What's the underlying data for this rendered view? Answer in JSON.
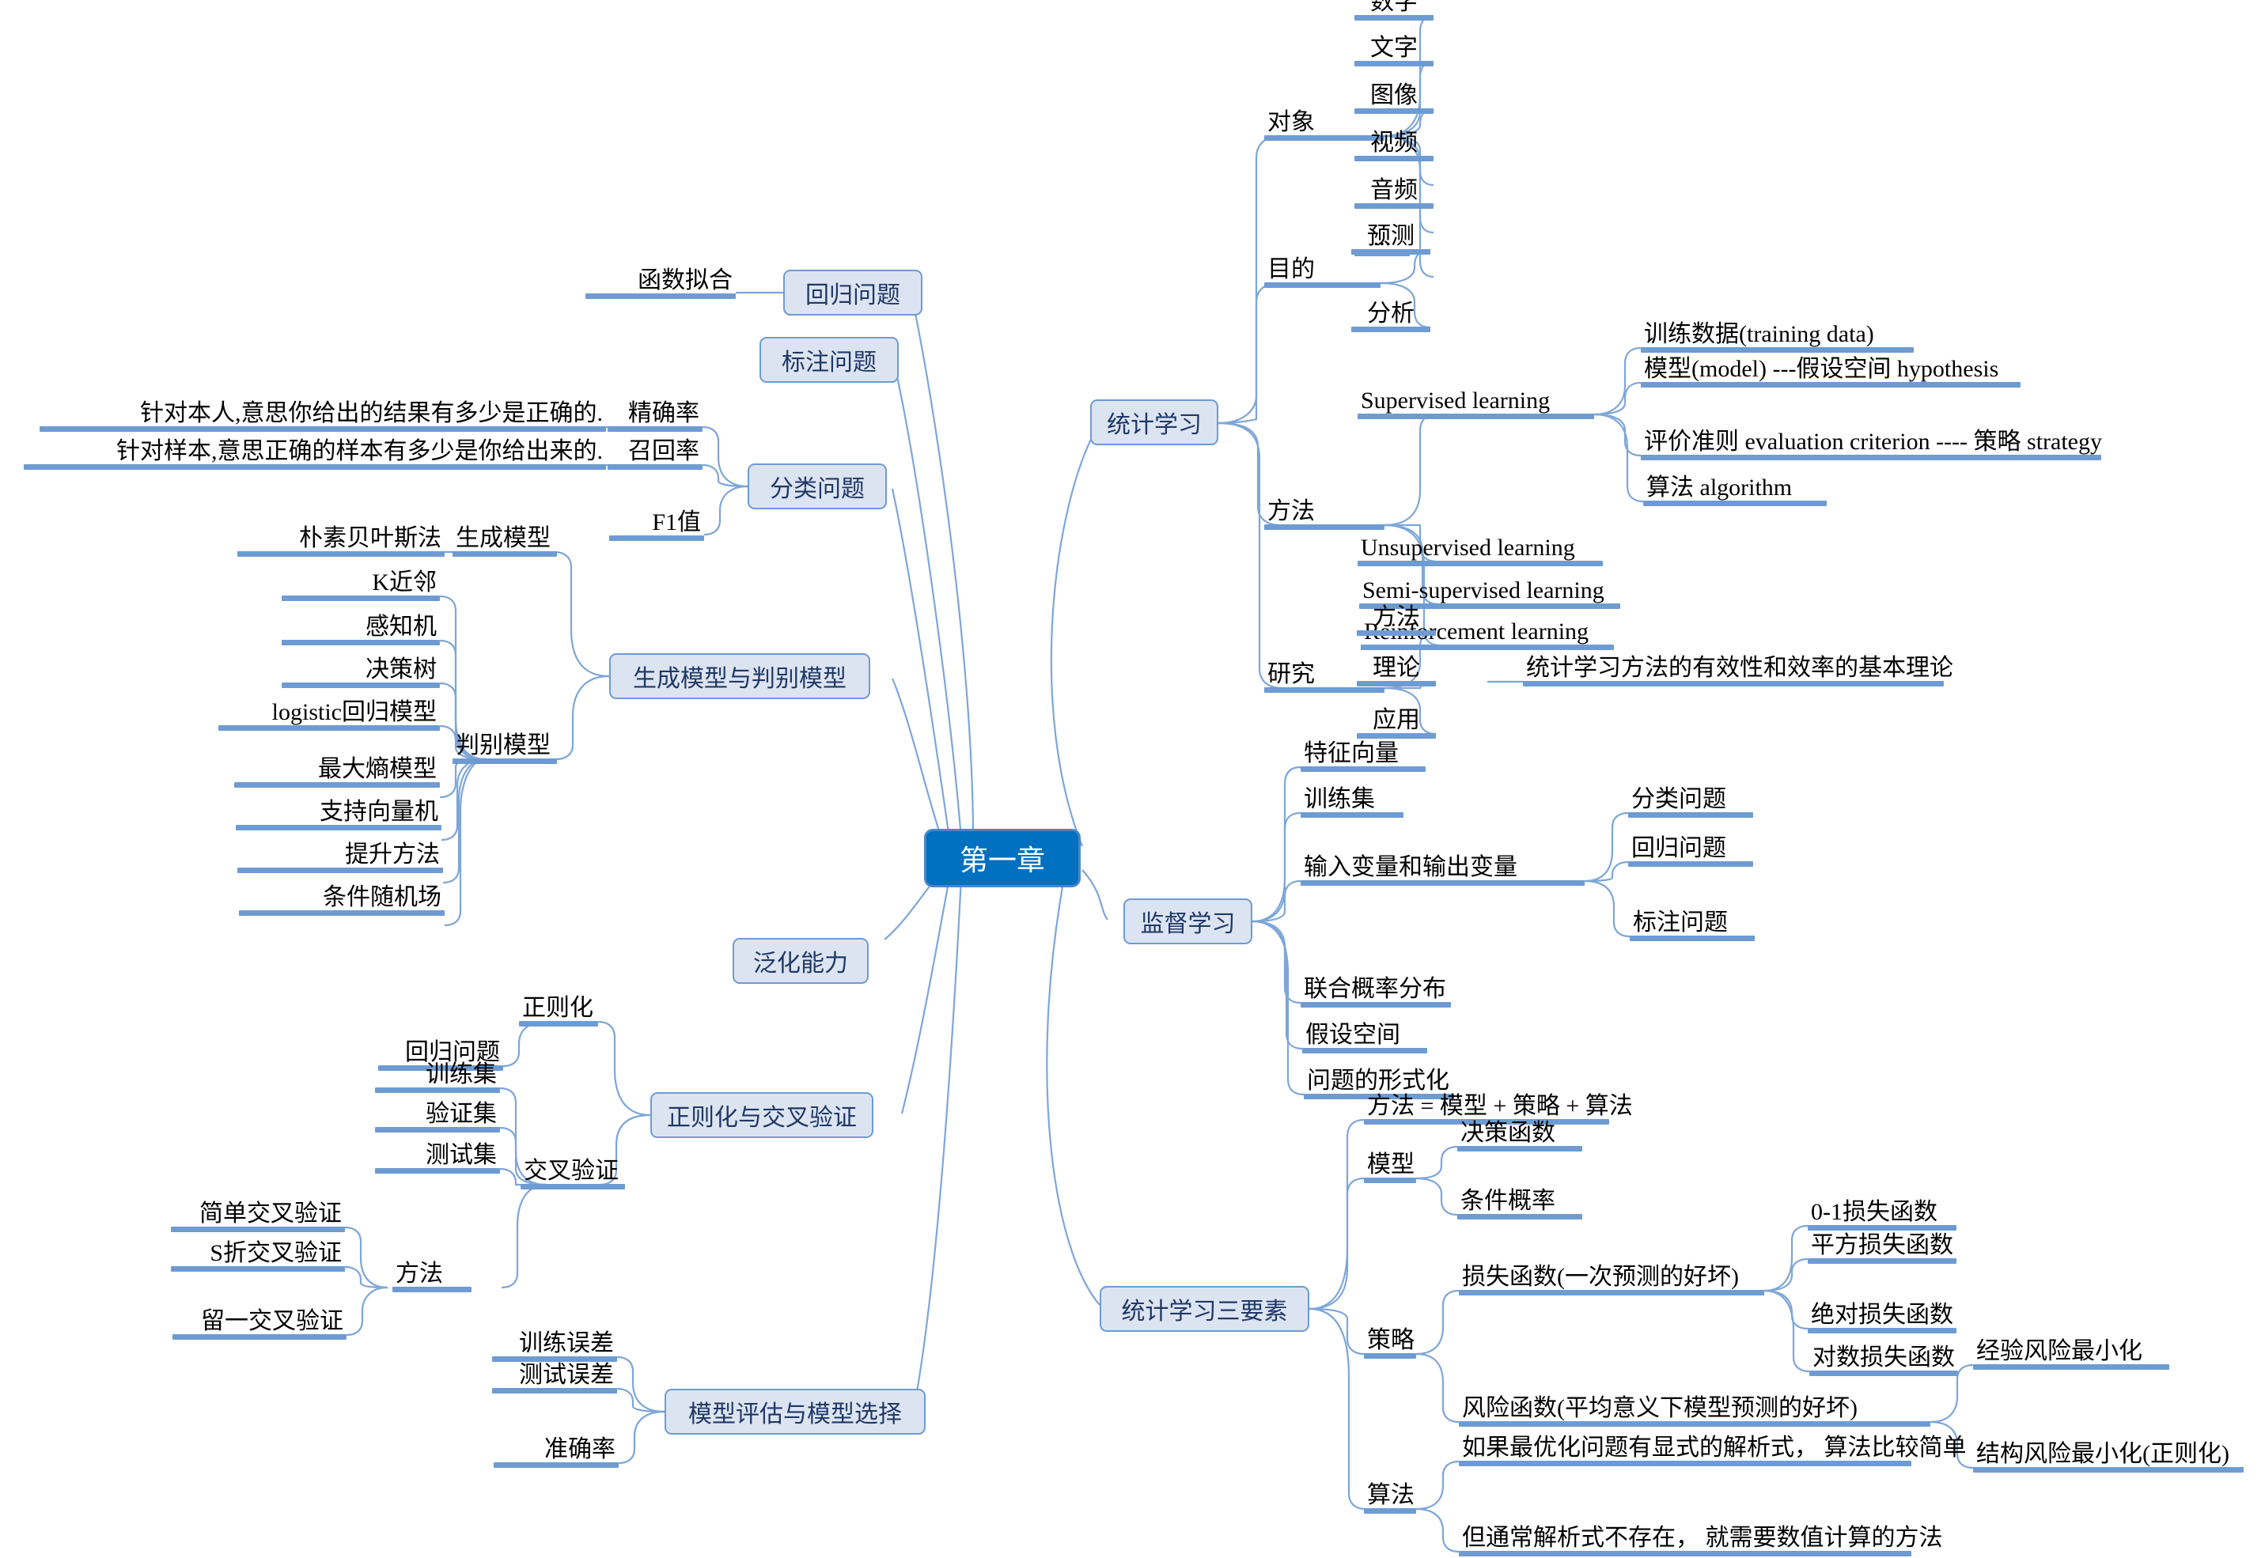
{
  "mindmap": {
    "root": {
      "label": "第一章"
    },
    "branches": {
      "statistical_learning": {
        "label": "统计学习",
        "object": {
          "label": "对象",
          "items": [
            "数字",
            "文字",
            "图像",
            "视频",
            "音频",
            "..."
          ]
        },
        "purpose": {
          "label": "目的",
          "items": [
            "预测",
            "分析"
          ]
        },
        "method": {
          "label": "方法",
          "supervised": {
            "label": "Supervised learning",
            "items": [
              "训练数据(training data)",
              "模型(model) ---假设空间 hypothesis",
              "评价准则 evaluation criterion ---- 策略 strategy",
              "算法 algorithm"
            ]
          },
          "others": [
            "Unsupervised learning",
            "Semi-supervised learning",
            "Reinforcement learning"
          ]
        },
        "research": {
          "label": "研究",
          "items": [
            "方法",
            "理论",
            "应用"
          ],
          "theory_note": "统计学习方法的有效性和效率的基本理论"
        }
      },
      "supervised_learning": {
        "label": "监督学习",
        "items": [
          "特征向量",
          "训练集",
          "输入变量和输出变量",
          "联合概率分布",
          "假设空间",
          "问题的形式化"
        ],
        "io_children": [
          "分类问题",
          "回归问题",
          "标注问题"
        ]
      },
      "three_elements": {
        "label": "统计学习三要素",
        "formula": "方法 = 模型 + 策略 + 算法",
        "model": {
          "label": "模型",
          "items": [
            "决策函数",
            "条件概率"
          ]
        },
        "strategy": {
          "label": "策略",
          "loss": {
            "label": "损失函数(一次预测的好坏)",
            "items": [
              "0-1损失函数",
              "平方损失函数",
              "绝对损失函数",
              "对数损失函数"
            ]
          },
          "risk": {
            "label": "风险函数(平均意义下模型预测的好坏)",
            "items": [
              "经验风险最小化",
              "结构风险最小化(正则化)"
            ]
          }
        },
        "algorithm": {
          "label": "算法",
          "items": [
            "如果最优化问题有显式的解析式，  算法比较简单",
            "但通常解析式不存在，  就需要数值计算的方法"
          ]
        }
      },
      "model_evaluation": {
        "label": "模型评估与模型选择",
        "items": [
          "训练误差",
          "测试误差",
          "准确率"
        ]
      },
      "regularization_cv": {
        "label": "正则化与交叉验证",
        "regularization": {
          "label": "正则化",
          "child": "回归问题"
        },
        "cross_validation": {
          "label": "交叉验证",
          "sets": [
            "训练集",
            "验证集",
            "测试集"
          ],
          "method_label": "方法",
          "methods": [
            "简单交叉验证",
            "S折交叉验证",
            "留一交叉验证"
          ]
        }
      },
      "generalization": {
        "label": "泛化能力"
      },
      "gen_disc_models": {
        "label": "生成模型与判别模型",
        "generative": {
          "label": "生成模型",
          "items": [
            "朴素贝叶斯法"
          ]
        },
        "discriminative": {
          "label": "判别模型",
          "items": [
            "K近邻",
            "感知机",
            "决策树",
            "logistic回归模型",
            "最大熵模型",
            "支持向量机",
            "提升方法",
            "条件随机场"
          ]
        }
      },
      "classification": {
        "label": "分类问题",
        "metrics": [
          "精确率",
          "召回率",
          "F1值"
        ],
        "notes": [
          "针对本人,意思你给出的结果有多少是正确的.",
          "针对样本,意思正确的样本有多少是你给出来的."
        ]
      },
      "tagging": {
        "label": "标注问题"
      },
      "regression": {
        "label": "回归问题",
        "child": "函数拟合"
      }
    },
    "colors": {
      "root_fill": "#0070C0",
      "node_fill": "#DCE4F2",
      "node_border": "#6E9BD2",
      "underline": "#6E9BD2",
      "edge": "#7EA6D8",
      "text": "#000000",
      "node_text": "#1F3864"
    }
  }
}
